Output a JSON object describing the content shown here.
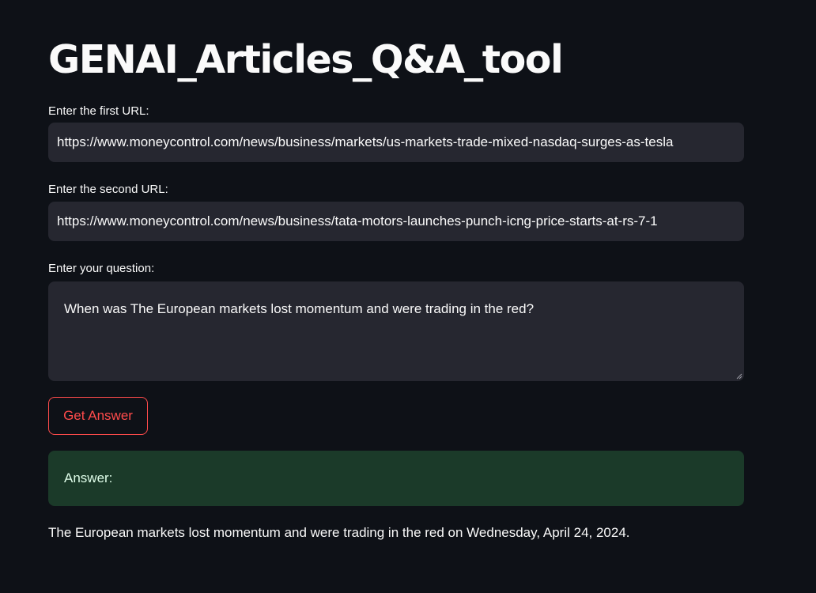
{
  "app": {
    "title": "GENAI_Articles_Q&A_tool"
  },
  "form": {
    "url1_label": "Enter the first URL:",
    "url1_value": "https://www.moneycontrol.com/news/business/markets/us-markets-trade-mixed-nasdaq-surges-as-tesla",
    "url2_label": "Enter the second URL:",
    "url2_value": "https://www.moneycontrol.com/news/business/tata-motors-launches-punch-icng-price-starts-at-rs-7-1",
    "question_label": "Enter your question:",
    "question_value": "When was The European markets lost momentum and were trading in the red?",
    "submit_label": "Get Answer"
  },
  "result": {
    "heading": "Answer:",
    "text": "The European markets lost momentum and were trading in the red on Wednesday, April 24, 2024."
  },
  "colors": {
    "background": "#0e1117",
    "input_background": "#262730",
    "accent": "#ff4b4b",
    "success_background": "#1b3a29"
  }
}
